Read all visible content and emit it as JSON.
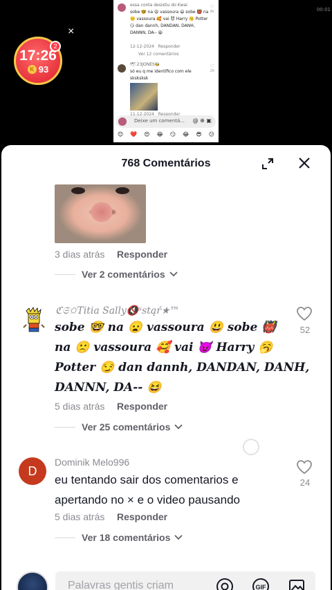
{
  "video": {
    "c1_user": "essa conta desistiu do Kwai",
    "c1_text": "sobe 🤓 na 😦 vassoura 😃 sobe 👹 na 🙁 vassoura 🥰 vai 😈 Harry 🥱 Potter 😏 dan dannh, DANDAN, DANH, DANNN, DA-- 😆",
    "c1_date": "12-12-2024",
    "c1_reply": "Responder",
    "c1_likes": "8k",
    "c1_more": "Ver 12 comentários",
    "c2_user": "🕊:23JONES🐝",
    "c2_text": "só eu q me identifico com ele sksksksk",
    "c2_likes": "26",
    "c2_date": "11-12-2024",
    "c2_reply": "Responder",
    "input_placeholder": "Deixe um comentá...",
    "emojis": [
      "😊",
      "❤️",
      "😍",
      "😂",
      "😏",
      "😂",
      "😎",
      "😕"
    ],
    "clock": "00:01"
  },
  "timer": {
    "time": "17:26",
    "coin_label": "K",
    "coins": "93",
    "badge_count": "2"
  },
  "sheet": {
    "title": "768 Comentários"
  },
  "comments": [
    {
      "meta": "3 dias atrás",
      "reply": "Responder",
      "view_more": "Ver 2 comentários"
    },
    {
      "username": "ℭ𝔖✩𝑇𝑖𝑡𝑖𝑎 𝑆𝑎𝑙𝑙𝑦🔇ˢstąŕ★™",
      "line1": "sobe 🤓 na 😦 vassoura 😃 sobe 👹",
      "line2": "na 🙁 vassoura 🥰 vai 😈 Harry 🥱",
      "line3": "Potter 😏 dan dannh, DANDAN, DANH,",
      "line4": "DANNN, DA-- 😆",
      "likes": "52",
      "meta": "5 dias atrás",
      "reply": "Responder",
      "view_more": "Ver 25 comentários"
    },
    {
      "avatar_letter": "D",
      "username": "Dominik Melo996",
      "line1": "eu tentando sair dos comentarios e",
      "line2": "apertando no × e o video pausando",
      "likes": "24",
      "meta": "5 dias atrás",
      "reply": "Responder",
      "view_more": "Ver 18 comentários"
    }
  ],
  "input": {
    "placeholder": "Palavras gentis criam"
  }
}
